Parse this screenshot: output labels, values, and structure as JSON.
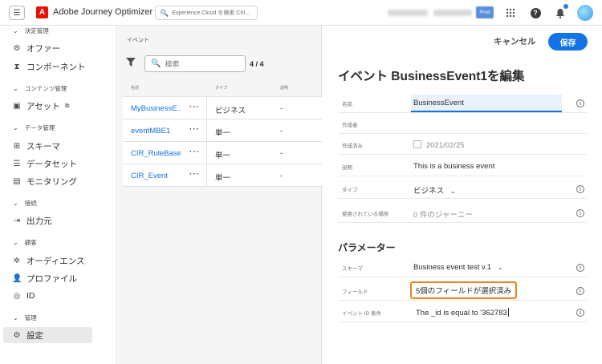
{
  "topbar": {
    "app_title": "Adobe Journey Optimizer",
    "logo_glyph": "A",
    "search_placeholder": "Experience Cloud を検索 Ctrl...",
    "badge": "Prod"
  },
  "nav": {
    "sections": {
      "decision": "決定管理",
      "content": "コンテンツ管理",
      "data": "データ管理",
      "connections": "接続",
      "customer": "顧客",
      "admin": "管理"
    },
    "items": {
      "offers": "オファー",
      "components": "コンポーネント",
      "assets": "アセット",
      "schemas": "スキーマ",
      "datasets": "データセット",
      "monitoring": "モニタリング",
      "destinations": "出力元",
      "audiences": "オーディエンス",
      "profiles": "プロファイル",
      "id": "ID",
      "settings": "設定"
    }
  },
  "list": {
    "title": "イベント",
    "search_placeholder": "検索",
    "count": "4 / 4",
    "columns": [
      "名前",
      "タイプ",
      "説明"
    ],
    "rows": [
      {
        "name": "MyBusinessE...",
        "type": "ビジネス",
        "desc": "-"
      },
      {
        "name": "eventMBE1",
        "type": "単一",
        "desc": "-"
      },
      {
        "name": "CIR_RuleBased",
        "type": "単一",
        "desc": "-"
      },
      {
        "name": "CIR_Event",
        "type": "単一",
        "desc": "-"
      }
    ]
  },
  "edit": {
    "cancel": "キャンセル",
    "save": "保存",
    "title": "イベント BusinessEvent1を編集",
    "fields": {
      "name_label": "名前",
      "name_value": "BusinessEvent",
      "author_label": "作成者",
      "created_label": "作成済み",
      "created_value": "2021/02/25",
      "desc_label": "説明",
      "desc_value": "This is a business event",
      "type_label": "タイプ",
      "type_value": "ビジネス",
      "used_label": "使用されている場所",
      "used_value": "0 件のジャーニー"
    },
    "params_title": "パラメーター",
    "params": {
      "schema_label": "スキーマ",
      "schema_value": "Business event test v.1",
      "fields_label": "フィールド",
      "fields_value": "5個のフィールドが選択済み",
      "condition_label": "イベント ID 条件",
      "condition_value": "The _id is equal to '362783"
    }
  }
}
